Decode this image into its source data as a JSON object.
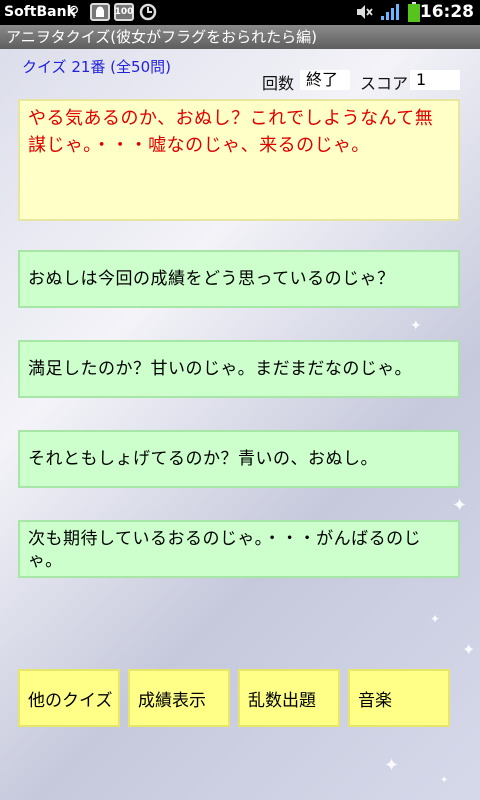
{
  "status_bar": {
    "carrier": "SoftBank",
    "time": "16:28",
    "icons": [
      "usb-icon",
      "android-debug-icon",
      "battery-100-icon",
      "sync-icon",
      "mute-icon",
      "signal-icon",
      "battery-icon"
    ]
  },
  "app": {
    "title": "アニヲタクイズ(彼女がフラグをおられたら編)"
  },
  "quiz": {
    "number_label": "クイズ 21番 (全50問)",
    "round_label": "回数",
    "round_value": "終了",
    "score_label": "スコア",
    "score_value": "1"
  },
  "question": {
    "text": "やる気あるのか、おぬし？これでしようなんて無謀じゃ。・・・嘘なのじゃ、来るのじゃ。"
  },
  "answers": [
    "おぬしは今回の成績をどう思っているのじゃ？",
    "満足したのか？甘いのじゃ。まだまだなのじゃ。",
    "それともしょげてるのか？青いの、おぬし。",
    "次も期待しているおるのじゃ。・・・がんばるのじゃ。"
  ],
  "buttons": {
    "other_quiz": "他のクイズ",
    "show_results": "成績表示",
    "random_questions": "乱数出題",
    "music": "音楽"
  }
}
